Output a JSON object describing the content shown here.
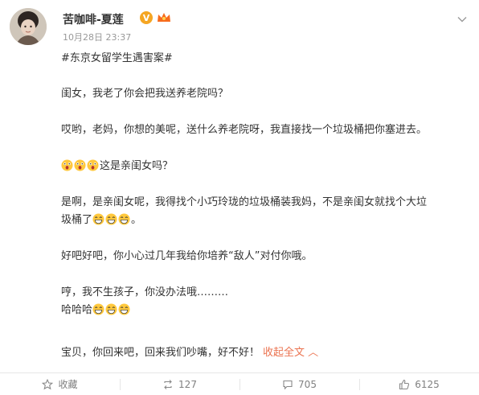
{
  "user": {
    "name": "苦咖啡-夏莲",
    "verified_badge": "V",
    "post_time": "10月28日 23:37"
  },
  "post": {
    "hashtag": "#东京女留学生遇害案#",
    "lines": [
      "闺女，我老了你会把我送养老院吗？",
      "哎哟，老妈，你想的美呢，送什么养老院呀，我直接找一个垃圾桶把你塞进去。",
      "这是亲闺女吗？",
      "是啊，是亲闺女呢，我得找个小巧玲珑的垃圾桶装我妈，不是亲闺女就找个大垃",
      "圾桶了",
      "。",
      "好吧好吧，你小心过几年我给你培养“敌人”对付你哦。",
      "哼，我不生孩子，你没办法哦………",
      "哈哈哈",
      "宝贝，你回来吧，回来我们吵嘴，好不好！"
    ],
    "expand_label": "收起全文",
    "expand_arrow": "︿"
  },
  "actions": {
    "favorite_label": "收藏",
    "repost_count": "127",
    "comment_count": "705",
    "like_count": "6125"
  },
  "icons": {
    "menu": "chevron-down-icon",
    "favorite": "star-icon",
    "repost": "repost-icon",
    "comment": "comment-icon",
    "like": "thumbs-up-icon"
  },
  "colors": {
    "text": "#333333",
    "muted": "#999999",
    "link": "#eb7350",
    "verified": "#f5a623"
  }
}
